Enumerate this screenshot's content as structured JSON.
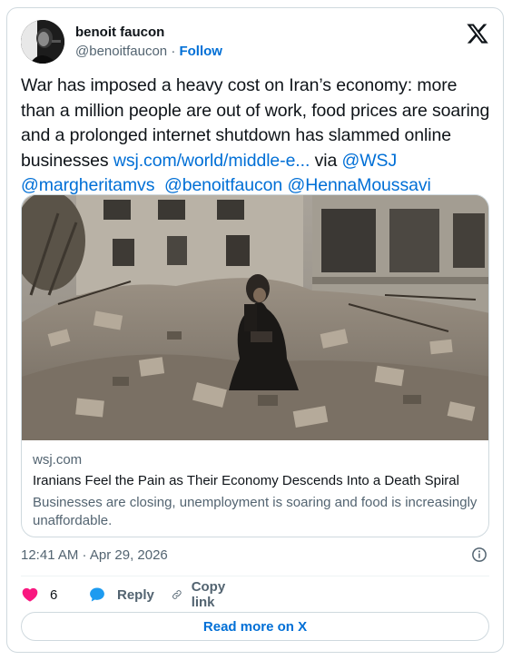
{
  "author": {
    "name": "benoit faucon",
    "handle": "@benoitfaucon",
    "separator": "·",
    "follow_label": "Follow"
  },
  "tweet": {
    "text_before_link": "War has imposed a heavy cost on Iran’s economy: more than a million people are out of work, food prices are soaring and a prolonged internet shutdown has slammed online businesses ",
    "link": "wsj.com/world/middle-e...",
    "via_text": " via ",
    "mention_wsj": "@WSJ",
    "mention_1": "@margheritamvs",
    "mention_2": "@benoitfaucon",
    "mention_3": "@HennaMoussavi"
  },
  "link_card": {
    "domain": "wsj.com",
    "title": "Iranians Feel the Pain as Their Economy Descends Into a Death Spiral",
    "description": "Businesses are closing, unemployment is soaring and food is increasingly unaffordable."
  },
  "timestamp": "12:41 AM · Apr 29, 2026",
  "actions": {
    "like_count": "6",
    "reply_label": "Reply",
    "copy_link_label": "Copy link"
  },
  "read_more_label": "Read more on X",
  "colors": {
    "link": "#006fd6",
    "like": "#f91880",
    "reply_icon": "#1d9bf0",
    "muted": "#536471",
    "border": "#cfd9de"
  },
  "icons": [
    "x-logo-icon",
    "info-icon",
    "heart-icon",
    "reply-bubble-icon",
    "link-chain-icon"
  ]
}
